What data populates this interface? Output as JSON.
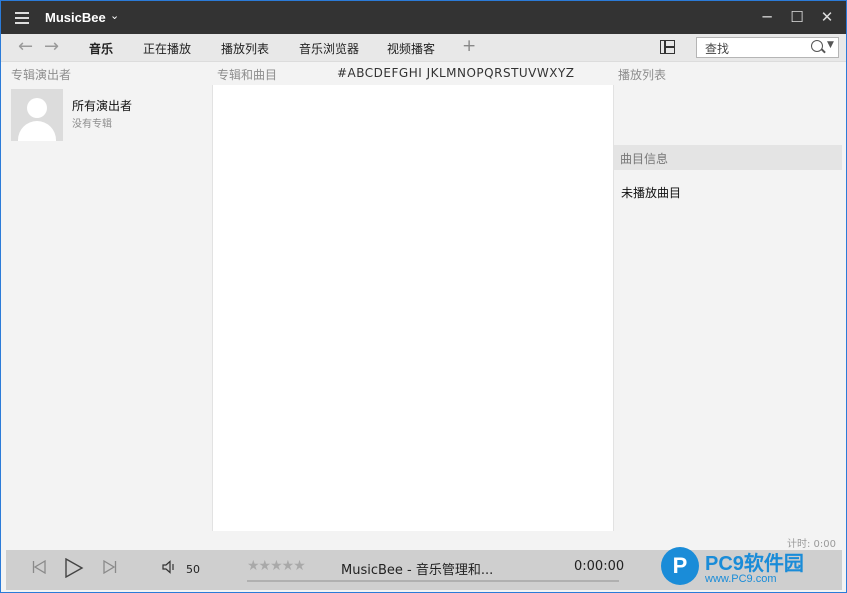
{
  "titlebar": {
    "title": "MusicBee",
    "menu_icon": "hamburger-icon",
    "title_menu_icon": "chevron-down-icon",
    "minimize_icon": "minimize-icon",
    "maximize_icon": "maximize-icon",
    "close_icon": "close-icon",
    "minimize_glyph": "─",
    "maximize_glyph": "☐",
    "close_glyph": "✕"
  },
  "nav": {
    "back_icon": "arrow-left-icon",
    "forward_icon": "arrow-right-icon",
    "tabs": [
      {
        "label": "音乐",
        "active": true
      },
      {
        "label": "正在播放",
        "active": false
      },
      {
        "label": "播放列表",
        "active": false
      },
      {
        "label": "音乐浏览器",
        "active": false
      },
      {
        "label": "视频播客",
        "active": false
      }
    ],
    "add_tab_glyph": "+",
    "layout_icon": "layout-panels-icon",
    "search_placeholder": "查找",
    "search_icon": "search-icon"
  },
  "columns": {
    "artists": "专辑演出者",
    "albums": "专辑和曲目",
    "alphabet": "#ABCDEFGHI JKLMNOPQRSTUVWXYZ",
    "playlist": "播放列表"
  },
  "artist_panel": {
    "items": [
      {
        "name": "所有演出者",
        "sub": "没有专辑",
        "avatar_icon": "artist-placeholder-icon"
      }
    ]
  },
  "track_info": {
    "header": "曲目信息",
    "now": "未播放曲目"
  },
  "timer": "计时: 0:00",
  "player": {
    "prev_icon": "skip-previous-icon",
    "play_icon": "play-icon",
    "next_icon": "skip-next-icon",
    "volume_icon": "volume-icon",
    "volume": "50",
    "rating_stars": "★★★★★",
    "rating": 0,
    "track": "MusicBee - 音乐管理和...",
    "time": "0:00:00",
    "progress": 0
  },
  "watermark": {
    "logo": "P",
    "name": "PC9软件园",
    "url": "www.PC9.com"
  },
  "colors": {
    "titlebar": "#333333",
    "navbar": "#e8e8e8",
    "panel": "#f3f3f3",
    "player": "#cfcfcf",
    "window_border": "#2b7bd8",
    "watermark": "#1a8cd8"
  }
}
